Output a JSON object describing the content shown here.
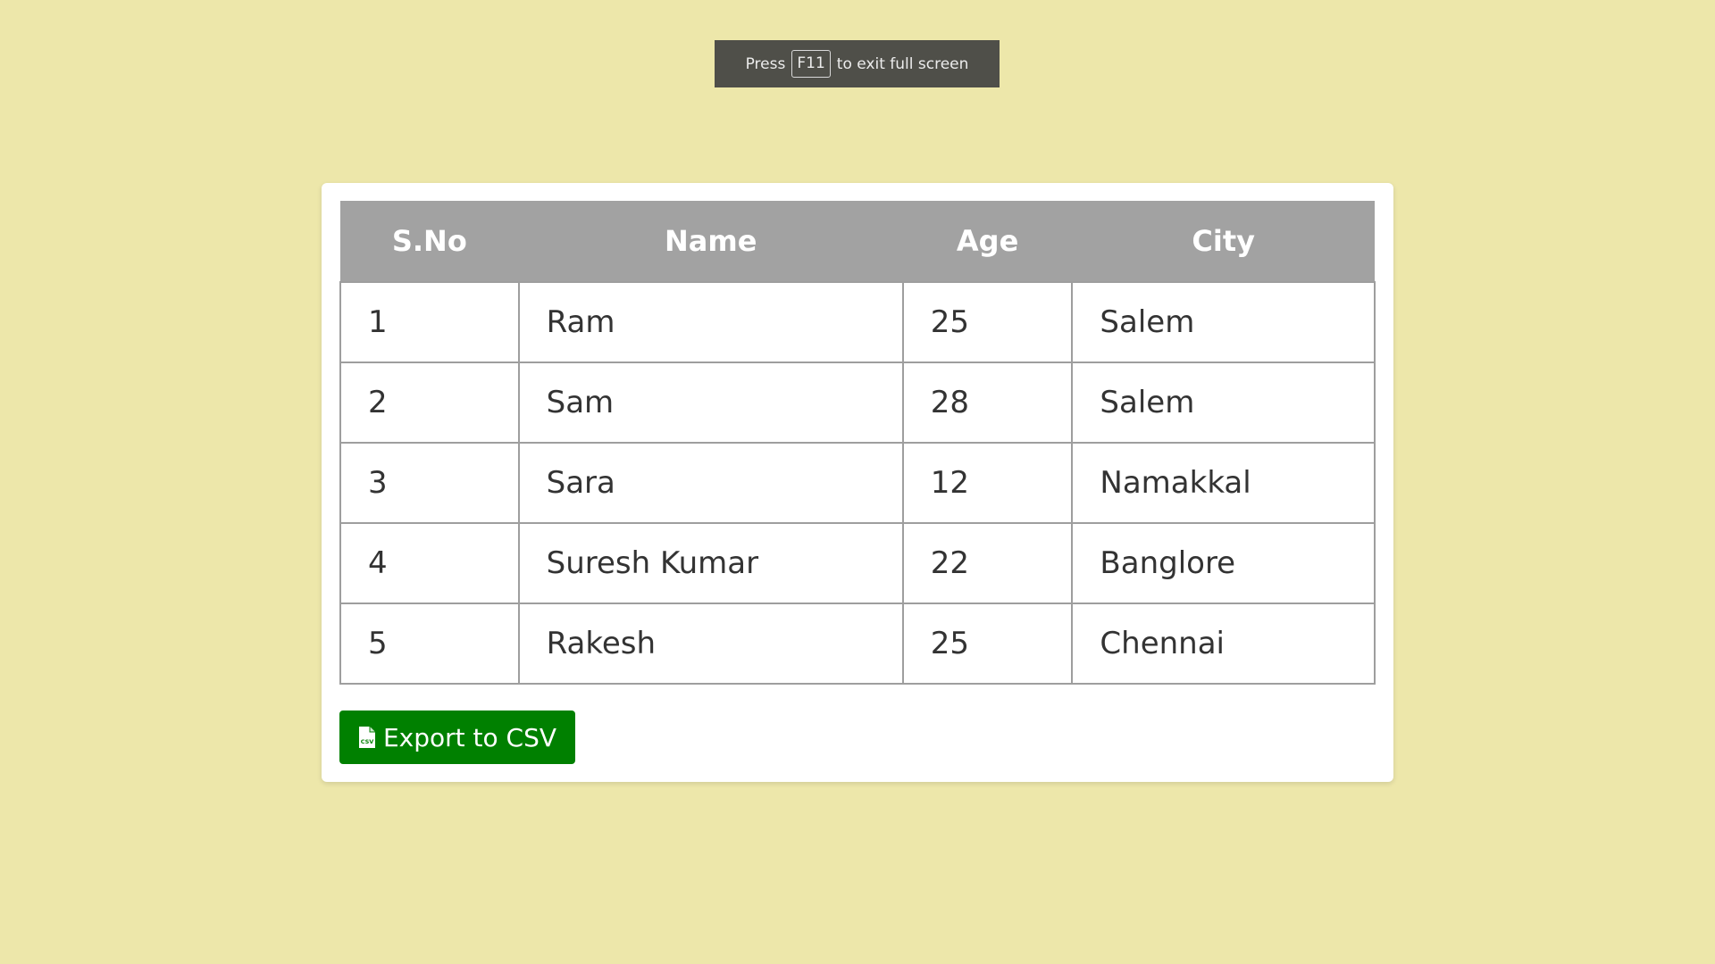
{
  "fullscreen_notice": {
    "prefix": "Press",
    "key": "F11",
    "suffix": "to exit full screen"
  },
  "table": {
    "headers": [
      "S.No",
      "Name",
      "Age",
      "City"
    ],
    "rows": [
      [
        "1",
        "Ram",
        "25",
        "Salem"
      ],
      [
        "2",
        "Sam",
        "28",
        "Salem"
      ],
      [
        "3",
        "Sara",
        "12",
        "Namakkal"
      ],
      [
        "4",
        "Suresh Kumar",
        "22",
        "Banglore"
      ],
      [
        "5",
        "Rakesh",
        "25",
        "Chennai"
      ]
    ]
  },
  "export_button": {
    "label": "Export to CSV",
    "icon": "csv-file-icon"
  },
  "colors": {
    "page_background": "#EDE7AA",
    "header_background": "#A2A2A2",
    "button_background": "#008000",
    "banner_background": "#4F4F49"
  }
}
